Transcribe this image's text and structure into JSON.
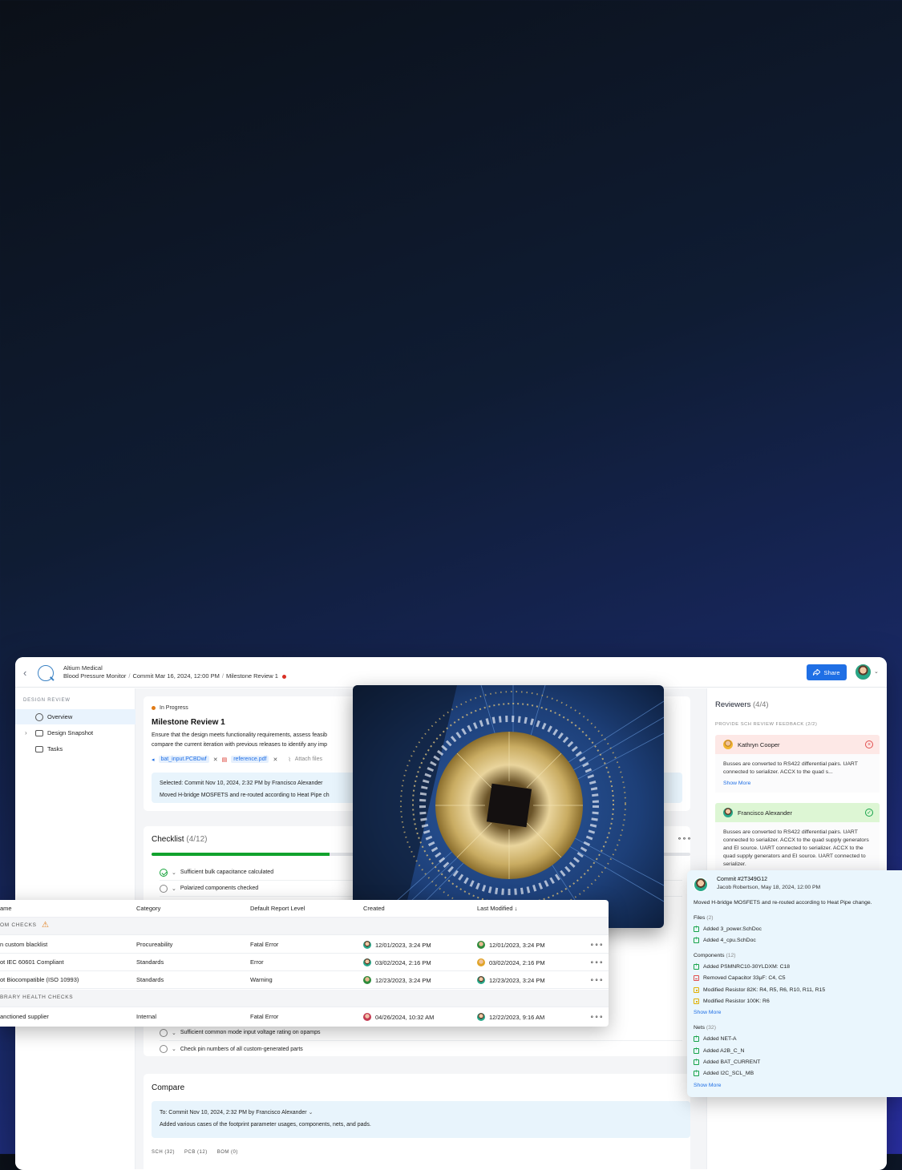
{
  "topbar": {
    "org": "Altium Medical",
    "project": "Blood Pressure Monitor",
    "commit": "Commit Mar 16, 2024, 12:00 PM",
    "milestone": "Milestone Review 1",
    "share_label": "Share"
  },
  "sidebar": {
    "heading": "DESIGN REVIEW",
    "items": [
      {
        "label": "Overview",
        "icon": "compass-icon",
        "active": true
      },
      {
        "label": "Design Snapshot",
        "icon": "folder-icon",
        "expandable": true
      },
      {
        "label": "Tasks",
        "icon": "book-icon"
      }
    ]
  },
  "milestone": {
    "status": "In Progress",
    "title": "Milestone Review 1",
    "description_1": "Ensure that the design meets functionality requirements, assess feasib",
    "description_2": "compare the current iteration with previous releases to identify any imp",
    "files": [
      "bat_input.PCBDwf",
      "reference.pdf"
    ],
    "attach_label": "Attach files",
    "selected_line": "Selected: Commit Nov 10, 2024, 2:32 PM by Francisco Alexander",
    "selected_desc": "Moved H-bridge MOSFETS and re-routed according to Heat Pipe ch"
  },
  "checklist": {
    "title": "Checklist",
    "count": "(4/12)",
    "progress": 0.33,
    "items": [
      {
        "label": "Sufficient bulk capacitance calculated",
        "done": true
      },
      {
        "label": "Polarized components checked",
        "done": false
      },
      {
        "label": "Sufficient common mode input voltage rating on opamps",
        "done": false
      },
      {
        "label": "Check pin numbers of all custom-generated parts",
        "done": false
      }
    ]
  },
  "compare": {
    "title": "Compare",
    "to_line": "To: Commit Nov 10, 2024, 2:32 PM by Francisco Alexander",
    "desc": "Added various cases of the footprint parameter usages, components, nets, and pads.",
    "tabs": [
      "SCH (32)",
      "PCB (12)",
      "BOM (0)"
    ]
  },
  "reviewers": {
    "title": "Reviewers",
    "count": "(4/4)",
    "section": "PROVIDE SCH  REVIEW FEEDBACK (2/2)",
    "items": [
      {
        "name": "Kathryn Cooper",
        "state": "rejected",
        "color": "#fde8e6",
        "text": "Busses are converted to RS422 differential pairs. UART connected to serializer. ACCX to the quad s...",
        "more": "Show More"
      },
      {
        "name": "Francisco Alexander",
        "state": "approved",
        "color": "#ddf6d4",
        "text": "Busses are converted to RS422 differential pairs. UART connected to serializer. ACCX to the quad supply generators and EI source. UART connected to serializer. ACCX to the quad supply generators and EI source. UART connected to serializer."
      }
    ]
  },
  "table": {
    "headers": [
      "ame",
      "Category",
      "Default Report Level",
      "Created",
      "Last Modified"
    ],
    "groups": [
      {
        "label": "OM CHECKS",
        "warning": true,
        "rows": [
          {
            "name": "n custom blacklist",
            "category": "Procureability",
            "level": "Fatal Error",
            "created": "12/01/2023, 3:24 PM",
            "modified": "12/01/2023, 3:24 PM"
          },
          {
            "name": "ot IEC 60601 Compliant",
            "category": "Standards",
            "level": "Error",
            "created": "03/02/2024, 2:16 PM",
            "modified": "03/02/2024, 2:16 PM"
          },
          {
            "name": "ot Biocompatible (ISO 10993)",
            "category": "Standards",
            "level": "Warning",
            "created": "12/23/2023, 3:24 PM",
            "modified": "12/23/2023, 3:24 PM"
          }
        ]
      },
      {
        "label": "BRARY HEALTH CHECKS",
        "warning": false,
        "rows": [
          {
            "name": "anctioned supplier",
            "category": "Internal",
            "level": "Fatal Error",
            "created": "04/26/2024, 10:32 AM",
            "modified": "12/22/2023, 9:16 AM"
          }
        ]
      }
    ]
  },
  "commit": {
    "title": "Commit #2T349G12",
    "author": "Jacob Robertson, May 18, 2024, 12:00 PM",
    "message": "Moved H-bridge MOSFETS and re-routed according to Heat Pipe change.",
    "files_label": "Files",
    "files_count": "(2)",
    "files": [
      {
        "type": "add",
        "text": "Added 3_power.SchDoc"
      },
      {
        "type": "add",
        "text": "Added 4_cpu.SchDoc"
      }
    ],
    "components_label": "Components",
    "components_count": "(12)",
    "components": [
      {
        "type": "add",
        "text": "Added PSMNRC10-30YLDXM: C18"
      },
      {
        "type": "rem",
        "text": "Removed Capacitor 33μF: C4, C5"
      },
      {
        "type": "mod",
        "text": "Modified Resistor 82K: R4, R5, R6, R10, R11, R15"
      },
      {
        "type": "mod",
        "text": "Modified Resistor 100K: R6"
      }
    ],
    "nets_label": "Nets",
    "nets_count": "(32)",
    "nets": [
      {
        "type": "add",
        "text": "Added NET-A"
      },
      {
        "type": "add",
        "text": "Added A2B_C_N"
      },
      {
        "type": "add",
        "text": "Added BAT_CURRENT"
      },
      {
        "type": "add",
        "text": "Added I2C_SCL_MB"
      }
    ],
    "show_more": "Show More"
  }
}
